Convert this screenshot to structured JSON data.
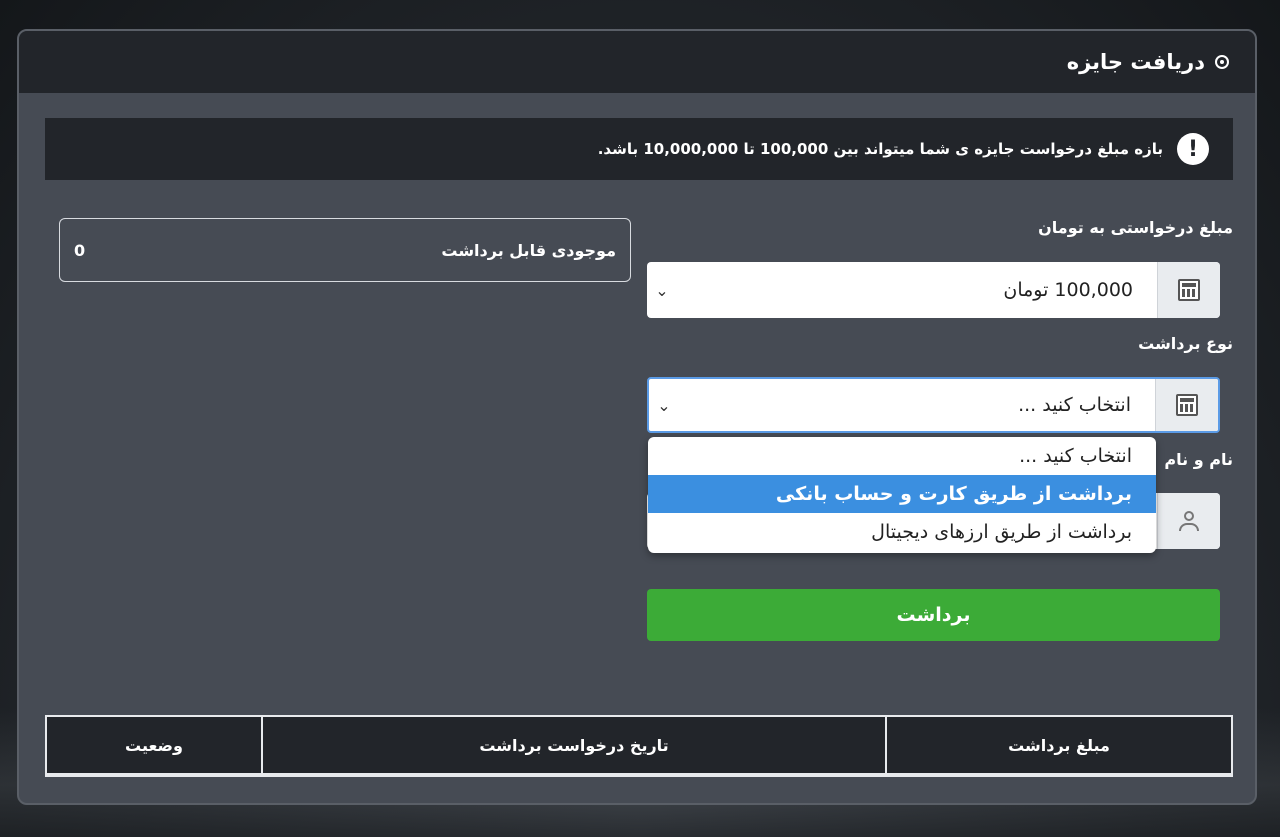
{
  "header": {
    "title": "دریافت جایزه",
    "icon": "target-icon"
  },
  "notice": {
    "text": "بازه مبلغ درخواست جایزه ی شما میتواند بین 100,000 تا 10,000,000 باشد.",
    "icon": "exclamation-icon"
  },
  "form": {
    "amount_label": "مبلغ درخواستی به تومان",
    "amount_value": "100,000 تومان",
    "withdraw_type_label": "نوع برداشت",
    "withdraw_type_value": "انتخاب کنید ...",
    "name_label": "نام و نام",
    "submit_label": "برداشت"
  },
  "balance": {
    "label": "موجودی قابل برداشت",
    "value": "0"
  },
  "dropdown": {
    "options": [
      "انتخاب کنید ...",
      "برداشت از طریق کارت و حساب بانکی",
      "برداشت از طریق ارزهای دیجیتال"
    ],
    "highlighted_index": 1
  },
  "table": {
    "headers": [
      "مبلغ برداشت",
      "تاریخ درخواست برداشت",
      "وضعیت"
    ]
  },
  "colors": {
    "accent": "#3cab37",
    "highlight": "#3b8fe0",
    "panel": "#464b54",
    "dark": "#22252a"
  }
}
